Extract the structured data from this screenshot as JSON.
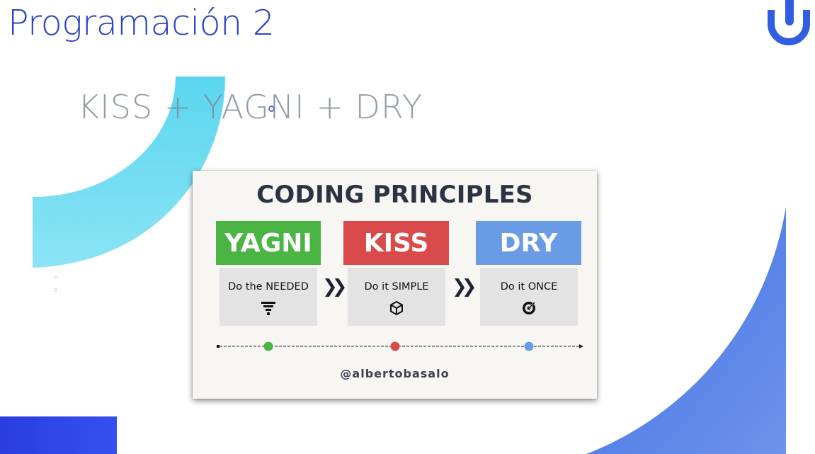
{
  "slide": {
    "title": "Programación 2",
    "subtitle": "KISS + YAGNI + DRY"
  },
  "card": {
    "title": "CODING PRINCIPLES",
    "handle": "@albertobasalo",
    "principles": [
      {
        "name": "YAGNI",
        "description": "Do the NEEDED",
        "color": "#4bb543",
        "icon": "funnel-icon"
      },
      {
        "name": "KISS",
        "description": "Do it SIMPLE",
        "color": "#d94b4b",
        "icon": "cube-icon"
      },
      {
        "name": "DRY",
        "description": "Do it ONCE",
        "color": "#6a9ce6",
        "icon": "target-icon"
      }
    ],
    "arrow_glyph": "❯❯"
  },
  "colors": {
    "title_blue": "#2a43c6",
    "accent_cyan": "#6fdcf2",
    "accent_blue": "#4a74e0"
  }
}
